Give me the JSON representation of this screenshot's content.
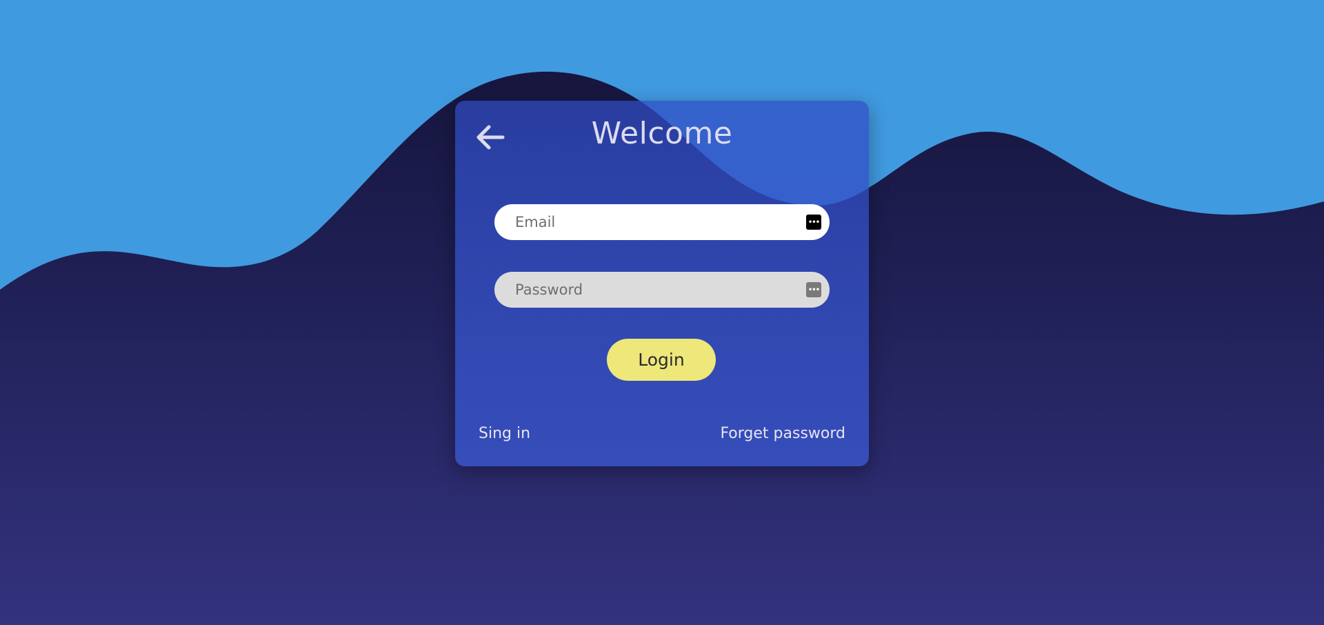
{
  "colors": {
    "sky": "#409ae0",
    "background_top": "#141236",
    "background_bottom": "#33327e",
    "card": "#3850c8",
    "login_button": "#eee77a",
    "text": "#dcdcf0"
  },
  "card": {
    "back_icon": "arrow-left-icon",
    "title": "Welcome",
    "email": {
      "placeholder": "Email",
      "value": "",
      "icon": "password-manager-key-icon"
    },
    "password": {
      "placeholder": "Password",
      "value": "",
      "icon": "password-manager-key-icon"
    },
    "login_label": "Login",
    "signin_label": "Sing in",
    "forget_label": "Forget password"
  }
}
